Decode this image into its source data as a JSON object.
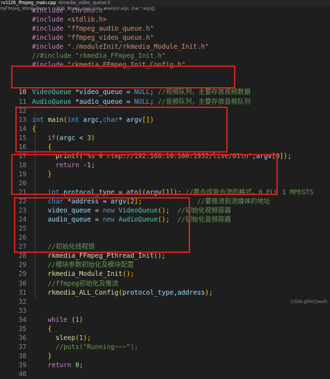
{
  "tabs": [
    {
      "label": "rv1126_ffmpeg_main.cpp",
      "active": true
    },
    {
      "label": "rkmedia_video_queue.h",
      "active": false
    }
  ],
  "breadcrumb": [
    "myFfmpeg_Mbmp_Demo",
    "rv1126_ffmpeg_main.cpp",
    "main(int argc, char * argv[])"
  ],
  "watermark": "CSDN @RVChenPi",
  "lines": [
    {
      "n": "",
      "tokens": [
        {
          "t": "#include \"chrono.h\"",
          "c": "inc"
        }
      ]
    },
    {
      "n": "",
      "tokens": [
        {
          "t": "#include ",
          "c": "inc"
        },
        {
          "t": "<stdlib.h>",
          "c": "str"
        }
      ]
    },
    {
      "n": "",
      "tokens": [
        {
          "t": "#include ",
          "c": "inc"
        },
        {
          "t": "\"ffmpeg_audio_queue.h\"",
          "c": "str"
        }
      ]
    },
    {
      "n": "",
      "tokens": [
        {
          "t": "#include ",
          "c": "inc"
        },
        {
          "t": "\"ffmpeg_video_queue.h\"",
          "c": "str"
        }
      ]
    },
    {
      "n": "",
      "tokens": [
        {
          "t": "#include ",
          "c": "inc"
        },
        {
          "t": "\"./moduleInit/rkmedia_Module_Init.h\"",
          "c": "str"
        }
      ]
    },
    {
      "n": "",
      "tokens": [
        {
          "t": "//#include \"rkmedia_FFmpeg_Init.h\"",
          "c": "cmt"
        }
      ]
    },
    {
      "n": "",
      "tokens": [
        {
          "t": "#include ",
          "c": "inc"
        },
        {
          "t": "\"rkmedia_FFmpeg_Init_Config.h\"",
          "c": "str"
        }
      ]
    },
    {
      "n": "",
      "tokens": []
    },
    {
      "n": "",
      "tokens": []
    },
    {
      "n": "10",
      "tokens": [
        {
          "t": "VideoQueue",
          "c": "typ"
        },
        {
          "t": " *",
          "c": "pl"
        },
        {
          "t": "video_queue",
          "c": "var"
        },
        {
          "t": " = ",
          "c": "pl"
        },
        {
          "t": "NULL",
          "c": "kw"
        },
        {
          "t": "; ",
          "c": "pl"
        },
        {
          "t": "//视频队列，主要存放视频数据",
          "c": "cmt"
        }
      ]
    },
    {
      "n": "11",
      "tokens": [
        {
          "t": "AudioQueue",
          "c": "typ"
        },
        {
          "t": " *",
          "c": "pl"
        },
        {
          "t": "audio_queue",
          "c": "var"
        },
        {
          "t": " = ",
          "c": "pl"
        },
        {
          "t": "NULL",
          "c": "kw"
        },
        {
          "t": "; ",
          "c": "pl"
        },
        {
          "t": "//音频队列，主要存放音频队列",
          "c": "cmt"
        }
      ]
    },
    {
      "n": "12",
      "tokens": []
    },
    {
      "n": "13",
      "tokens": [
        {
          "t": "int",
          "c": "kw"
        },
        {
          "t": " ",
          "c": "pl"
        },
        {
          "t": "main",
          "c": "fn"
        },
        {
          "t": "(",
          "c": "br"
        },
        {
          "t": "int",
          "c": "kw"
        },
        {
          "t": " ",
          "c": "pl"
        },
        {
          "t": "argc",
          "c": "var"
        },
        {
          "t": ",",
          "c": "pl"
        },
        {
          "t": "char",
          "c": "kw"
        },
        {
          "t": "* ",
          "c": "pl"
        },
        {
          "t": "argv",
          "c": "var"
        },
        {
          "t": "[])",
          "c": "br"
        }
      ]
    },
    {
      "n": "14",
      "tokens": [
        {
          "t": "{",
          "c": "br"
        }
      ]
    },
    {
      "n": "15",
      "tokens": [
        {
          "t": "    ",
          "c": "pl"
        },
        {
          "t": "if",
          "c": "ctl"
        },
        {
          "t": "(",
          "c": "br"
        },
        {
          "t": "argc",
          "c": "var"
        },
        {
          "t": " < ",
          "c": "pl"
        },
        {
          "t": "3",
          "c": "num"
        },
        {
          "t": ")",
          "c": "br"
        }
      ]
    },
    {
      "n": "16",
      "tokens": [
        {
          "t": "    {",
          "c": "br"
        }
      ]
    },
    {
      "n": "17",
      "tokens": [
        {
          "t": "      ",
          "c": "pl"
        },
        {
          "t": "printf",
          "c": "fn"
        },
        {
          "t": "(",
          "c": "br"
        },
        {
          "t": "\"%s 0 rtmp://192.168.10.100:1932/live/01\\n\"",
          "c": "str"
        },
        {
          "t": ",",
          "c": "pl"
        },
        {
          "t": "argv",
          "c": "var"
        },
        {
          "t": "[",
          "c": "br"
        },
        {
          "t": "0",
          "c": "num"
        },
        {
          "t": "]);",
          "c": "br"
        }
      ]
    },
    {
      "n": "18",
      "tokens": [
        {
          "t": "      ",
          "c": "pl"
        },
        {
          "t": "return",
          "c": "ctl"
        },
        {
          "t": " -",
          "c": "pl"
        },
        {
          "t": "1",
          "c": "num"
        },
        {
          "t": ";",
          "c": "pl"
        }
      ]
    },
    {
      "n": "19",
      "tokens": [
        {
          "t": "    }",
          "c": "br"
        }
      ]
    },
    {
      "n": "20",
      "tokens": []
    },
    {
      "n": "21",
      "tokens": [
        {
          "t": "    ",
          "c": "pl"
        },
        {
          "t": "int",
          "c": "kw"
        },
        {
          "t": " ",
          "c": "pl"
        },
        {
          "t": "protocol_type",
          "c": "var"
        },
        {
          "t": " = ",
          "c": "pl"
        },
        {
          "t": "atoi",
          "c": "fn"
        },
        {
          "t": "(",
          "c": "br"
        },
        {
          "t": "argv",
          "c": "var"
        },
        {
          "t": "[",
          "c": "br"
        },
        {
          "t": "1",
          "c": "num"
        },
        {
          "t": "]);",
          "c": "br"
        },
        {
          "t": " ",
          "c": "pl"
        },
        {
          "t": "//要合成复合流的格式，0 FLV 1 MPEGTS",
          "c": "cmt"
        }
      ]
    },
    {
      "n": "22",
      "tokens": [
        {
          "t": "    ",
          "c": "pl"
        },
        {
          "t": "char",
          "c": "kw"
        },
        {
          "t": " *",
          "c": "pl"
        },
        {
          "t": "address",
          "c": "var"
        },
        {
          "t": " = ",
          "c": "pl"
        },
        {
          "t": "argv",
          "c": "var"
        },
        {
          "t": "[",
          "c": "br"
        },
        {
          "t": "2",
          "c": "num"
        },
        {
          "t": "];",
          "c": "br"
        },
        {
          "t": "              ",
          "c": "pl"
        },
        {
          "t": "//要推流到流媒体的地址",
          "c": "cmt"
        }
      ]
    },
    {
      "n": "23",
      "tokens": [
        {
          "t": "    ",
          "c": "pl"
        },
        {
          "t": "video_queue",
          "c": "var"
        },
        {
          "t": " = ",
          "c": "pl"
        },
        {
          "t": "new",
          "c": "kw"
        },
        {
          "t": " ",
          "c": "pl"
        },
        {
          "t": "VideoQueue",
          "c": "typ"
        },
        {
          "t": "();",
          "c": "br"
        },
        {
          "t": "  ",
          "c": "pl"
        },
        {
          "t": "//初始化视频容器",
          "c": "cmt"
        }
      ]
    },
    {
      "n": "24",
      "tokens": [
        {
          "t": "    ",
          "c": "pl"
        },
        {
          "t": "audio_queue",
          "c": "var"
        },
        {
          "t": " = ",
          "c": "pl"
        },
        {
          "t": "new",
          "c": "kw"
        },
        {
          "t": " ",
          "c": "pl"
        },
        {
          "t": "AudioQueue",
          "c": "typ"
        },
        {
          "t": "();",
          "c": "br"
        },
        {
          "t": "  ",
          "c": "pl"
        },
        {
          "t": "//初始化音频容器",
          "c": "cmt"
        }
      ]
    },
    {
      "n": "25",
      "tokens": []
    },
    {
      "n": "26",
      "tokens": []
    },
    {
      "n": "27",
      "tokens": [
        {
          "t": "    ",
          "c": "pl"
        },
        {
          "t": "//初始化线程锁",
          "c": "cmt"
        }
      ]
    },
    {
      "n": "28",
      "tokens": [
        {
          "t": "    ",
          "c": "pl"
        },
        {
          "t": "rkmedia_FFmpeg_Pthread_Init",
          "c": "fn"
        },
        {
          "t": "();",
          "c": "br"
        }
      ]
    },
    {
      "n": "29",
      "tokens": [
        {
          "t": "    ",
          "c": "pl"
        },
        {
          "t": "//模块参数初始化及模块配置",
          "c": "cmt"
        }
      ]
    },
    {
      "n": "29",
      "tokens": [
        {
          "t": "    ",
          "c": "pl"
        },
        {
          "t": "rkmedia_Module_Init",
          "c": "fn"
        },
        {
          "t": "();",
          "c": "br"
        }
      ]
    },
    {
      "n": "30",
      "tokens": [
        {
          "t": "    ",
          "c": "pl"
        },
        {
          "t": "//ffmpeg初始化及推流",
          "c": "cmt"
        }
      ]
    },
    {
      "n": "31",
      "tokens": [
        {
          "t": "    ",
          "c": "pl"
        },
        {
          "t": "rkmedia_ALL_Config",
          "c": "fn"
        },
        {
          "t": "(",
          "c": "br"
        },
        {
          "t": "protocol_type",
          "c": "var"
        },
        {
          "t": ",",
          "c": "pl"
        },
        {
          "t": "address",
          "c": "var"
        },
        {
          "t": ");",
          "c": "br"
        }
      ]
    },
    {
      "n": "32",
      "tokens": []
    },
    {
      "n": "33",
      "tokens": []
    },
    {
      "n": "34",
      "tokens": [
        {
          "t": "    ",
          "c": "pl"
        },
        {
          "t": "while",
          "c": "ctl"
        },
        {
          "t": " (",
          "c": "br"
        },
        {
          "t": "1",
          "c": "num"
        },
        {
          "t": ")",
          "c": "br"
        }
      ]
    },
    {
      "n": "35",
      "tokens": [
        {
          "t": "    {",
          "c": "br"
        }
      ]
    },
    {
      "n": "36",
      "tokens": [
        {
          "t": "      ",
          "c": "pl"
        },
        {
          "t": "sleep",
          "c": "fn"
        },
        {
          "t": "(",
          "c": "br"
        },
        {
          "t": "1",
          "c": "num"
        },
        {
          "t": ");",
          "c": "br"
        }
      ]
    },
    {
      "n": "37",
      "tokens": [
        {
          "t": "      ",
          "c": "pl"
        },
        {
          "t": "//puts(\"Running~~~\");",
          "c": "cmt"
        }
      ]
    },
    {
      "n": "38",
      "tokens": [
        {
          "t": "    }",
          "c": "br"
        }
      ]
    },
    {
      "n": "39",
      "tokens": [
        {
          "t": "    ",
          "c": "pl"
        },
        {
          "t": "return",
          "c": "ctl"
        },
        {
          "t": " ",
          "c": "pl"
        },
        {
          "t": "0",
          "c": "num"
        },
        {
          "t": ";",
          "c": "pl"
        }
      ]
    },
    {
      "n": "40",
      "tokens": []
    }
  ]
}
